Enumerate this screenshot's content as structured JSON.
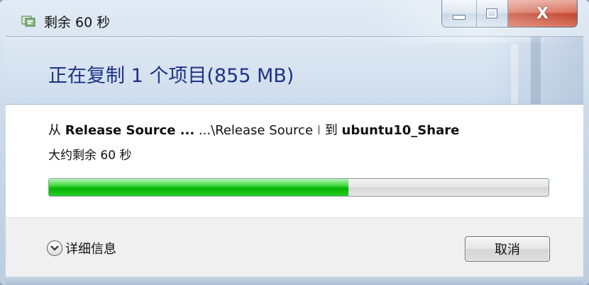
{
  "window": {
    "title": "剩余 60 秒",
    "icon": "file-copy-icon",
    "close_symbol": "X"
  },
  "header": {
    "title": "正在复制 1 个项目(855 MB)"
  },
  "copy": {
    "from_prefix": "从 ",
    "source_name": "Release Source ...",
    "source_path": "   ...\\Release Source ",
    "separator": "I",
    "to_prefix": " 到 ",
    "destination": "ubuntu10_Share",
    "time_remaining": "大约剩余 60 秒",
    "progress_fraction": 0.6
  },
  "footer": {
    "details_label": "详细信息",
    "cancel_label": "取消"
  },
  "colors": {
    "header_text": "#1e3287",
    "progress_green": "#06b305",
    "close_red": "#c0442b"
  }
}
